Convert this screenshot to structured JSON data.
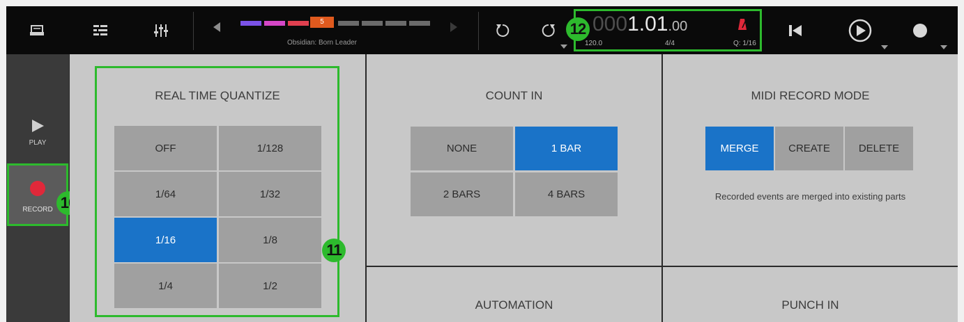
{
  "toolbar": {
    "browser_icon": "browser-tray-icon",
    "list_icon": "list-edit-icon",
    "mixer_icon": "mixer-sliders-icon",
    "sequence_number": "5",
    "sequence_name": "Obsidian: Born Leader",
    "sequence_colors": [
      "#7b52e8",
      "#d547c7",
      "#e04050",
      "#e05a1e",
      "#6b6b6b"
    ],
    "undo_icon": "undo-icon",
    "redo_icon": "redo-icon",
    "counter": {
      "dim_digits": "000",
      "bars": "1.01",
      "ticks": ".00",
      "tempo": "120.0",
      "time_signature": "4/4",
      "quantize": "Q: 1/16"
    },
    "metronome_icon": "metronome-icon",
    "metronome_color": "#e0283a",
    "rewind_icon": "skip-to-start-icon",
    "play_icon": "play-icon",
    "record_icon": "record-icon",
    "badge_12": "12"
  },
  "sidebar": {
    "play_label": "PLAY",
    "record_label": "RECORD",
    "record_color": "#e0283a",
    "badge_10": "10"
  },
  "quantize": {
    "title": "REAL TIME QUANTIZE",
    "options": [
      "OFF",
      "1/128",
      "1/64",
      "1/32",
      "1/16",
      "1/8",
      "1/4",
      "1/2"
    ],
    "selected": "1/16",
    "badge_11": "11"
  },
  "count_in": {
    "title": "COUNT IN",
    "options": [
      "NONE",
      "1 BAR",
      "2 BARS",
      "4 BARS"
    ],
    "selected": "1 BAR"
  },
  "midi_record_mode": {
    "title": "MIDI RECORD MODE",
    "options": [
      "MERGE",
      "CREATE",
      "DELETE"
    ],
    "selected": "MERGE",
    "description": "Recorded events are merged into existing parts"
  },
  "automation": {
    "title": "AUTOMATION"
  },
  "punch_in": {
    "title": "PUNCH IN"
  },
  "accent_color": "#1a73c8",
  "highlight_color": "#2dba2d"
}
